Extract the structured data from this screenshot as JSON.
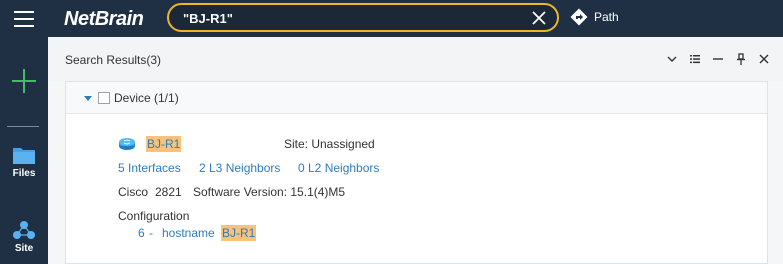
{
  "topbar": {
    "logo_text": "NetBrain",
    "search_value": "\"BJ-R1\"",
    "path_label": "Path"
  },
  "sidebar": {
    "items": [
      {
        "label": "Files"
      },
      {
        "label": "Site"
      }
    ]
  },
  "panel": {
    "title": "Search Results(3)"
  },
  "group": {
    "label": "Device (1/1)"
  },
  "result": {
    "device_name": "BJ-R1",
    "site": "Site: Unassigned",
    "interfaces_link": "5 Interfaces",
    "l3_link": "2 L3 Neighbors",
    "l2_link": "0 L2 Neighbors",
    "vendor": "Cisco",
    "model": "2821",
    "software": "Software Version: 15.1(4)M5",
    "config_label": "Configuration",
    "config_line_num": "6",
    "config_dash": "-",
    "config_keyword": "hostname",
    "config_match": "BJ-R1"
  },
  "colors": {
    "accent": "#f0b429",
    "highlight": "#f7c27a",
    "link": "#2d7dbe",
    "add": "#3fbf5f"
  }
}
